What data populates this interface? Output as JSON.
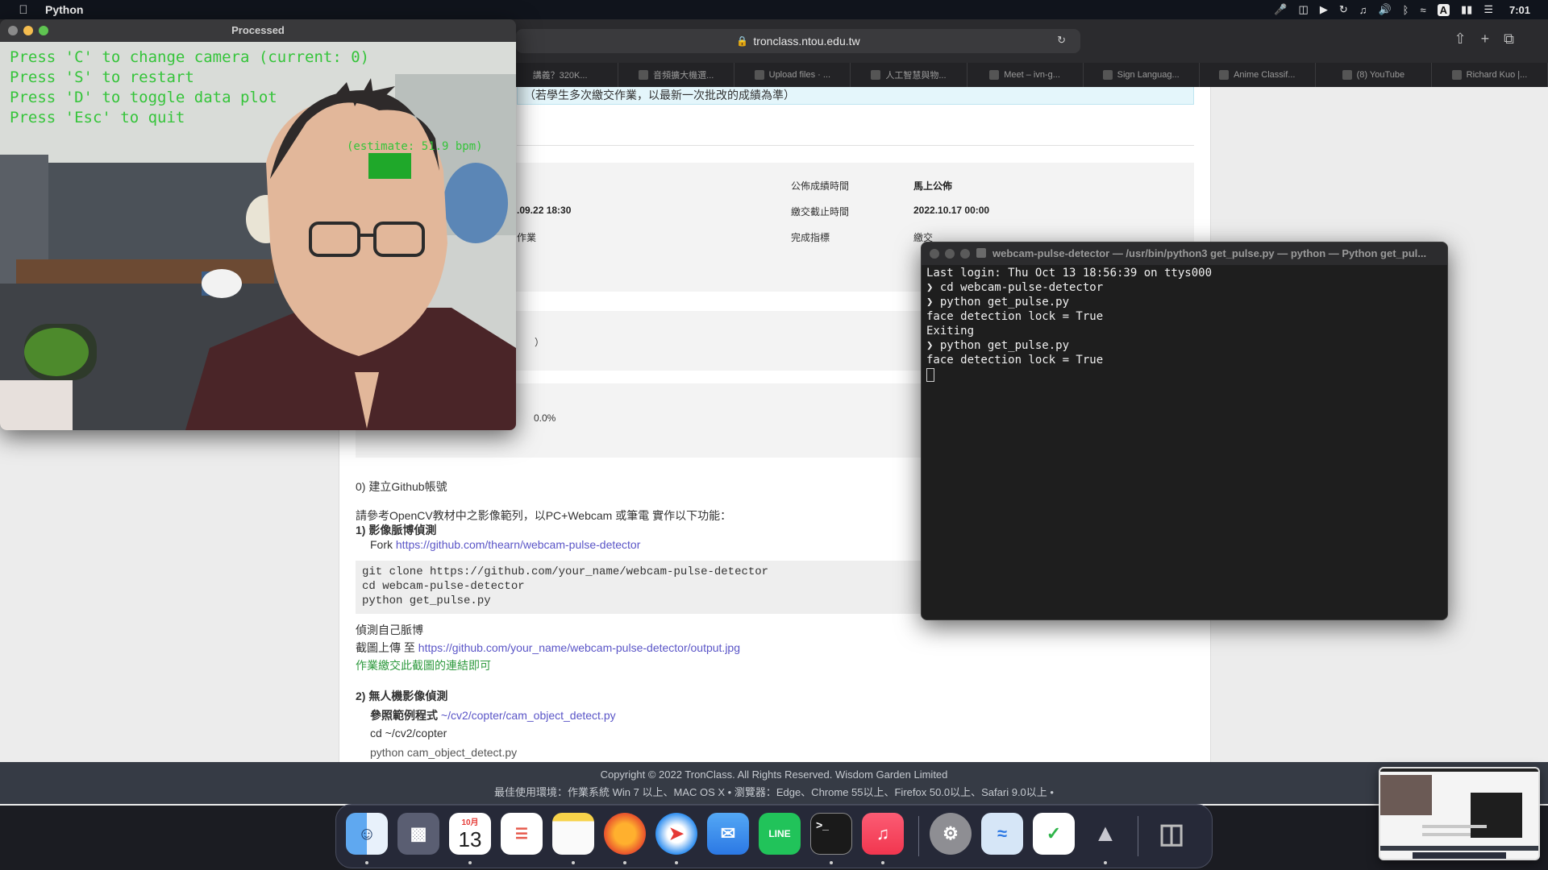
{
  "menubar": {
    "app_name": "Python",
    "clock": "7:01",
    "tray_items": [
      "mic-icon",
      "screen-mirror-icon",
      "play-icon",
      "time-machine-icon",
      "music-note-icon",
      "volume-icon",
      "bluetooth-icon",
      "wifi-icon",
      "input-a-icon",
      "battery-icon",
      "control-center-icon"
    ]
  },
  "safari": {
    "url": "tronclass.ntou.edu.tw",
    "tabs": [
      {
        "label": "講義？320K..."
      },
      {
        "label": "音頻擴大機選..."
      },
      {
        "label": "Upload files · ..."
      },
      {
        "label": "人工智慧與物..."
      },
      {
        "label": "Meet – ivn-g..."
      },
      {
        "label": "Sign Languag..."
      },
      {
        "label": "Anime Classif..."
      },
      {
        "label": "(8) YouTube"
      },
      {
        "label": "Richard Kuo |..."
      }
    ],
    "page": {
      "notice": "（若學生多次繳交作業，以最新一次批改的成績為準）",
      "publish_label": "公佈成績時間",
      "publish_value": "馬上公佈",
      "start_value": ".09.22 18:30",
      "deadline_label": "繳交截止時間",
      "deadline_value": "2022.10.17 00:00",
      "type_value": "作業",
      "completion_label": "完成指標",
      "completion_value": "繳交",
      "paren_text": "）",
      "percent_value": "0.0%",
      "step0": "0) 建立Github帳號",
      "intro": "請參考OpenCV教材中之影像範列，以PC+Webcam 或筆電 實作以下功能：",
      "step1": "1) 影像脈博偵測",
      "fork_label": "Fork",
      "fork_url": "https://github.com/thearn/webcam-pulse-detector",
      "code_lines": [
        "git clone https://github.com/your_name/webcam-pulse-detector",
        "cd webcam-pulse-detector",
        "python get_pulse.py"
      ],
      "detect_self": "偵測自己脈博",
      "upload_label": "截圖上傳 至",
      "upload_url": "https://github.com/your_name/webcam-pulse-detector/output.jpg",
      "submit_note": "作業繳交此截圖的連結即可",
      "step2": "2) 無人機影像偵測",
      "ref_label": "參照範例程式",
      "ref_path": "~/cv2/copter/cam_object_detect.py",
      "cd_line": "cd ~/cv2/copter",
      "cut_line": "python cam_object_detect.py"
    },
    "footer": {
      "line1": "Copyright © 2022 TronClass. All Rights Reserved. Wisdom Garden Limited",
      "line2": "最佳使用環境：作業系統 Win 7 以上、MAC OS X • 瀏覽器：Edge、Chrome 55以上、Firefox 50.0以上、Safari 9.0以上 •"
    }
  },
  "camera_window": {
    "title": "Processed",
    "overlay_lines": [
      "Press 'C' to change camera (current: 0)",
      "Press 'S' to restart",
      "Press 'D' to toggle data plot",
      "Press 'Esc' to quit"
    ],
    "estimate": "(estimate: 51.9 bpm)"
  },
  "terminal": {
    "title": "webcam-pulse-detector — /usr/bin/python3 get_pulse.py — python — Python get_pul...",
    "lines": [
      "Last login: Thu Oct 13 18:56:39 on ttys000",
      "❯ cd webcam-pulse-detector",
      "❯ python get_pulse.py",
      "face detection lock = True",
      "Exiting",
      "❯ python get_pulse.py",
      "face detection lock = True"
    ]
  },
  "dock": {
    "calendar_month": "10月",
    "calendar_day": "13",
    "items": [
      "Finder",
      "Launchpad",
      "Calendar",
      "Reminders",
      "Notes",
      "Firefox",
      "Safari",
      "Mail",
      "LINE",
      "Terminal",
      "Music",
      "System Preferences",
      "Wireless Diagnostics",
      "Security",
      "Rocket",
      "Trash"
    ]
  }
}
